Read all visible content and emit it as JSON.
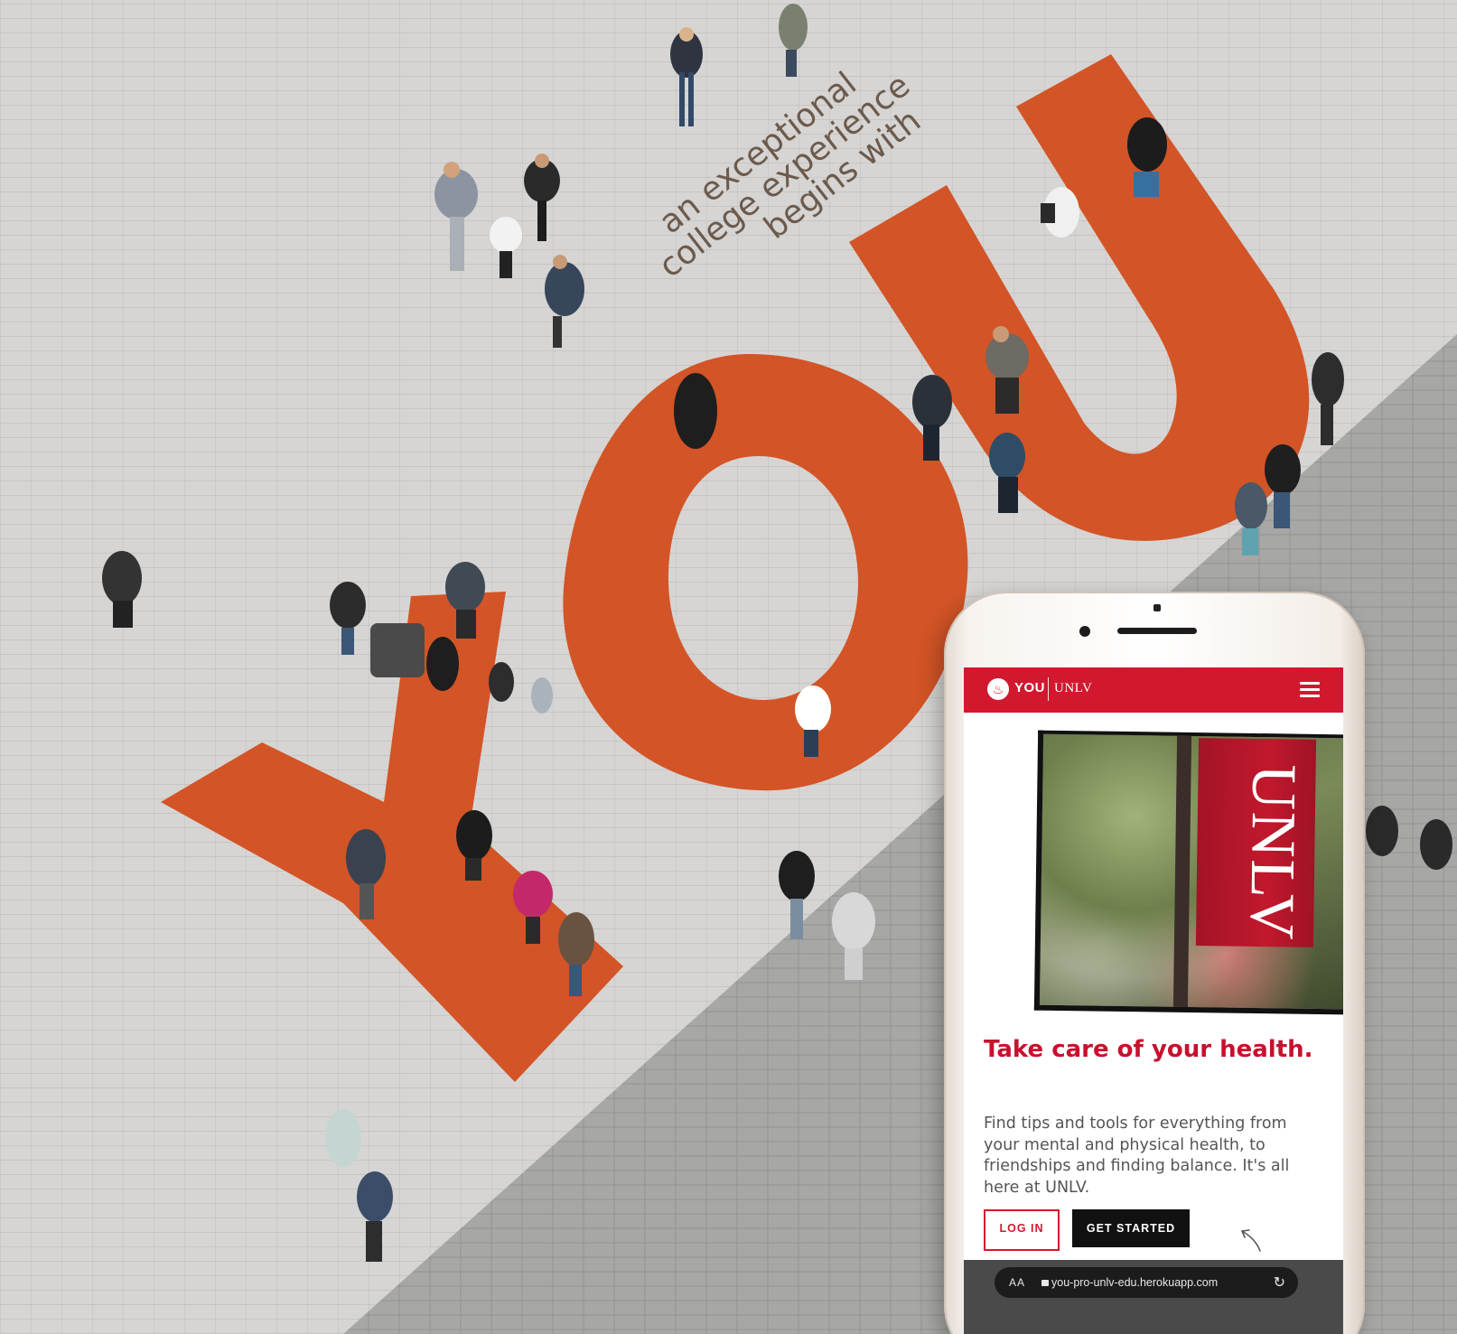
{
  "ad": {
    "tagline": [
      "an exceptional",
      "college experience",
      "begins with"
    ],
    "big_word": "YOU",
    "colors": {
      "letters": "#d35426",
      "plaza": "#d6d5d3",
      "tagline": "#6c5a4c"
    }
  },
  "phone_screen": {
    "header": {
      "logo_icon": "unlv-flame-logo-icon",
      "brand_you": "YOU",
      "brand_unlv": "UNLV",
      "menu_icon": "hamburger-menu-icon",
      "color": "#d2182f"
    },
    "hero": {
      "banner_text": "UNLV"
    },
    "headline": "Take care of your health.",
    "body": "Find tips and tools for everything from your mental and physical health, to friendships and finding balance. It's all here at UNLV.",
    "buttons": {
      "login": "LOG IN",
      "get_started": "GET STARTED"
    },
    "browser": {
      "aa": "AA",
      "url": "you-pro-unlv-edu.herokuapp.com",
      "reload_icon": "reload-icon"
    }
  }
}
